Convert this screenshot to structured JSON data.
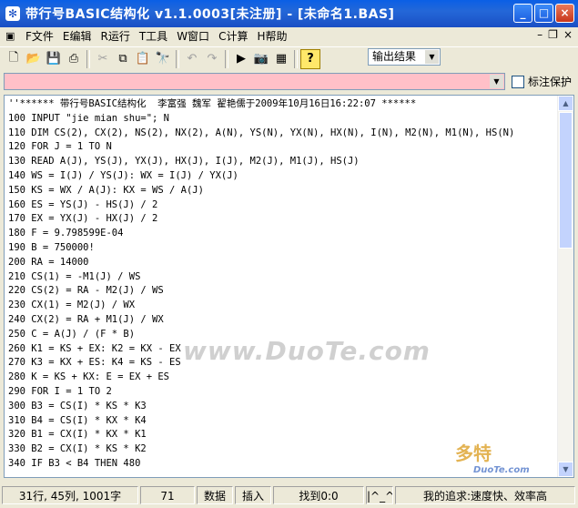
{
  "window": {
    "title": "带行号BASIC结构化 v1.1.0003[未注册] - [未命名1.BAS]",
    "app_icon": "✻",
    "btn_minimize": "_",
    "btn_maximize": "□",
    "btn_close": "×"
  },
  "menu": {
    "items": [
      {
        "label": "F文件"
      },
      {
        "label": "E编辑"
      },
      {
        "label": "R运行"
      },
      {
        "label": "T工具"
      },
      {
        "label": "W窗口"
      },
      {
        "label": "C计算"
      },
      {
        "label": "H帮助"
      }
    ],
    "mdi_min": "–",
    "mdi_restore": "❐",
    "mdi_close": "×"
  },
  "toolbar": {
    "output_select_value": "输出结果",
    "icons": [
      "new-file-icon",
      "open-folder-icon",
      "save-icon",
      "print-icon",
      "cut-icon",
      "copy-icon",
      "paste-icon",
      "find-icon",
      "undo-icon",
      "redo-icon",
      "run-icon",
      "camera-icon",
      "calculator-icon",
      "help-icon"
    ]
  },
  "lock_label": "标注保护",
  "code_lines": [
    "''****** 带行号BASIC结构化  李富强 魏军 翟艳儒于2009年10月16日16:22:07 ******",
    "100 INPUT \"jie mian shu=\"; N",
    "110 DIM CS(2), CX(2), NS(2), NX(2), A(N), YS(N), YX(N), HX(N), I(N), M2(N), M1(N), HS(N)",
    "120 FOR J = 1 TO N",
    "130 READ A(J), YS(J), YX(J), HX(J), I(J), M2(J), M1(J), HS(J)",
    "140 WS = I(J) / YS(J): WX = I(J) / YX(J)",
    "150 KS = WX / A(J): KX = WS / A(J)",
    "160 ES = YS(J) - HS(J) / 2",
    "170 EX = YX(J) - HX(J) / 2",
    "180 F = 9.798599E-04",
    "190 B = 750000!",
    "200 RA = 14000",
    "210 CS(1) = -M1(J) / WS",
    "220 CS(2) = RA - M2(J) / WS",
    "230 CX(1) = M2(J) / WX",
    "240 CX(2) = RA + M1(J) / WX",
    "250 C = A(J) / (F * B)",
    "260 K1 = KS + EX: K2 = KX - EX",
    "270 K3 = KX + ES: K4 = KS - ES",
    "280 K = KS + KX: E = EX + ES",
    "290 FOR I = 1 TO 2",
    "300 B3 = CS(I) * KS * K3",
    "310 B4 = CS(I) * KX * K4",
    "320 B1 = CX(I) * KX * K1",
    "330 B2 = CX(I) * KS * K2",
    "340 IF B3 < B4 THEN 480"
  ],
  "watermark": "www.DuoTe.com",
  "badge_text": "多特",
  "badge_sub": "DuoTe.com",
  "status": {
    "position": "31行, 45列, 1001字",
    "code": "71",
    "mode": "数据",
    "insert": "插入",
    "found": "找到0:0",
    "face": "|^_^|",
    "motto": "我的追求:速度快、效率高"
  }
}
